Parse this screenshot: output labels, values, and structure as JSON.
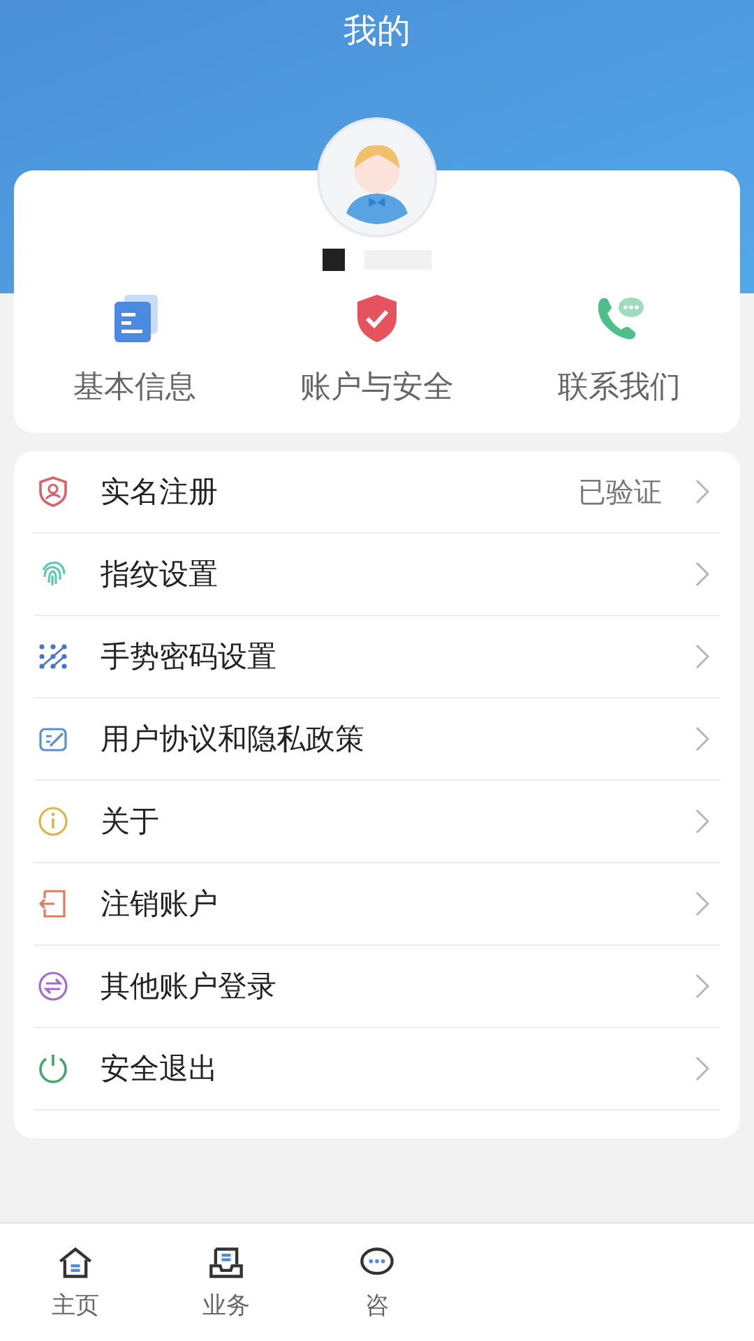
{
  "header": {
    "title": "我的"
  },
  "profile": {
    "shortcuts": [
      {
        "kind": "info",
        "label": "基本信息"
      },
      {
        "kind": "security",
        "label": "账户与安全"
      },
      {
        "kind": "contact",
        "label": "联系我们"
      }
    ]
  },
  "menu": [
    {
      "kind": "realname",
      "label": "实名注册",
      "value": "已验证"
    },
    {
      "kind": "fingerprint",
      "label": "指纹设置"
    },
    {
      "kind": "gesture",
      "label": "手势密码设置"
    },
    {
      "kind": "agreement",
      "label": "用户协议和隐私政策"
    },
    {
      "kind": "about",
      "label": "关于"
    },
    {
      "kind": "cancel",
      "label": "注销账户"
    },
    {
      "kind": "switch",
      "label": "其他账户登录"
    },
    {
      "kind": "logout",
      "label": "安全退出"
    }
  ],
  "tab_bar": [
    {
      "kind": "home",
      "label": "主页"
    },
    {
      "kind": "business",
      "label": "业务"
    },
    {
      "kind": "chat",
      "label": "咨"
    }
  ]
}
